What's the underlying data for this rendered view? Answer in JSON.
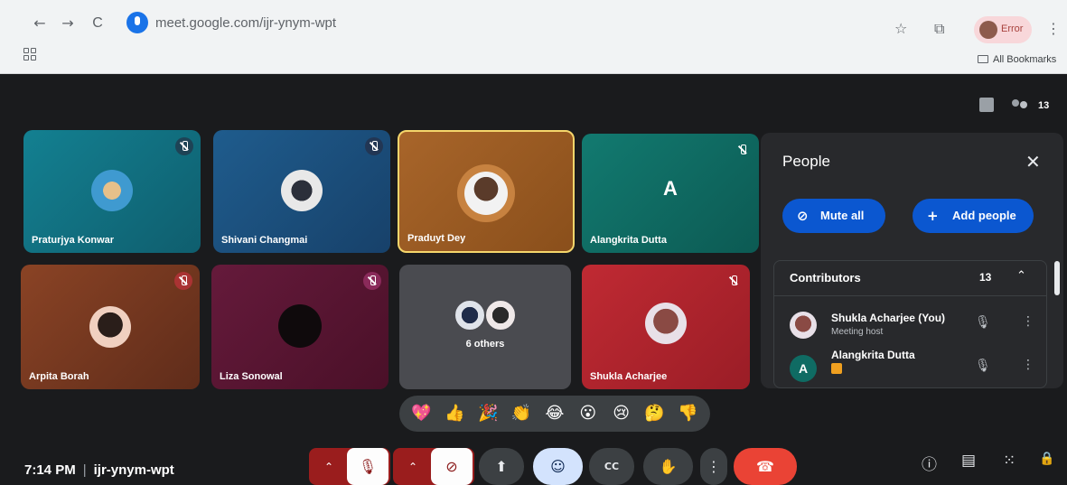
{
  "browser": {
    "url": "meet.google.com/ijr-ynym-wpt",
    "profile_label": "Error",
    "bookmarks_label": "All Bookmarks",
    "back_icon": "←",
    "forward_icon": "→",
    "reload_icon": "C",
    "star_icon": "☆",
    "extension_icon": "⧉",
    "menu_icon": "⋮"
  },
  "meet_top": {
    "participant_count": "13"
  },
  "tiles": [
    {
      "name": "Praturjya Konwar",
      "bg": "#17758a",
      "mic": "muted"
    },
    {
      "name": "Shivani Changmai",
      "bg": "#1e4f7d",
      "mic": "muted"
    },
    {
      "name": "Praduyt Dey",
      "bg": "#9c5a1f",
      "mic": "active"
    },
    {
      "name": "Alangkrita Dutta",
      "bg": "#0f6b63",
      "letter": "A",
      "mic": "muted"
    },
    {
      "name": "Arpita Borah",
      "bg": "#7a3a22",
      "mic": "muted"
    },
    {
      "name": "Liza Sonowal",
      "bg": "#5c1535",
      "mic": "muted"
    },
    {
      "name": "6 others",
      "bg": "#4a4b50",
      "mic": "none"
    },
    {
      "name": "Shukla Acharjee",
      "bg": "#b3262f",
      "mic": "muted"
    }
  ],
  "people_panel": {
    "title": "People",
    "close_icon": "✕",
    "mute_all_label": "Mute all",
    "mute_all_icon": "⊘",
    "add_people_label": "Add people",
    "add_people_icon": "+",
    "contributors_label": "Contributors",
    "contributors_count": "13",
    "collapse_icon": "⌃",
    "people": [
      {
        "name": "Shukla Acharjee (You)",
        "subtitle": "Meeting host",
        "avatar_color": "#8a4a44"
      },
      {
        "name": "Alangkrita Dutta",
        "subtitle": "",
        "letter": "A",
        "avatar_color": "#0f6b63"
      }
    ]
  },
  "reactions": [
    "💖",
    "👍",
    "🎉",
    "👏",
    "😂",
    "😮",
    "😢",
    "🤔",
    "👎"
  ],
  "meeting": {
    "time": "7:14 PM",
    "code": "ijr-ynym-wpt"
  },
  "controls": {
    "chevron_up": "⌃",
    "mic_off": "🎙",
    "cam_off": "⊘",
    "present": "⬆",
    "emoji": "☺",
    "captions": "CC",
    "raise_hand": "✋",
    "more": "⋮",
    "end_call": "☎"
  },
  "right_controls": {
    "info": "ⓘ",
    "chat": "▤",
    "activities": "⁙",
    "lock": "🔒"
  }
}
